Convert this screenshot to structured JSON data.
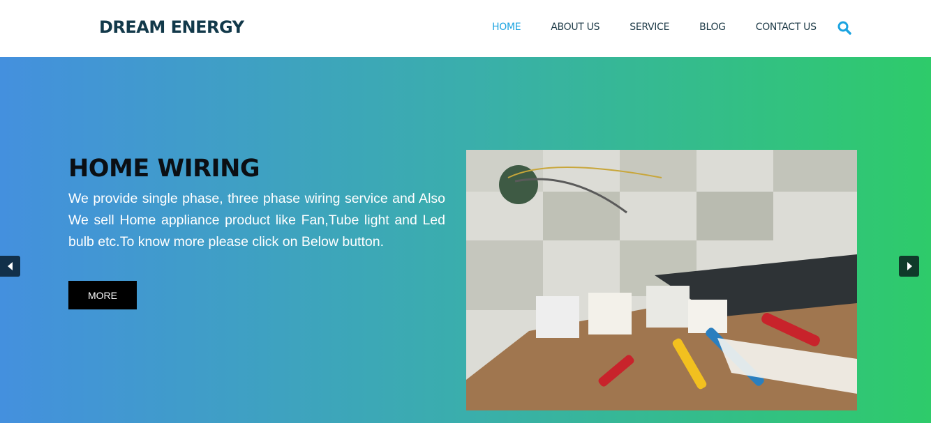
{
  "brand": "DREAM ENERGY",
  "nav": [
    {
      "label": "HOME",
      "active": true
    },
    {
      "label": "ABOUT US"
    },
    {
      "label": "SERVICE"
    },
    {
      "label": "BLOG"
    },
    {
      "label": "CONTACT US"
    }
  ],
  "colors": {
    "accent": "#1aa3e0",
    "brand": "#12394a",
    "gradient_start": "#4490de",
    "gradient_end": "#2ecb6a"
  },
  "slide": {
    "title": "HOME WIRING",
    "text": "We provide single phase, three phase wiring service and Also We sell Home appliance product like Fan,Tube light and Led bulb etc.To know more please click on Below button.",
    "button": "MORE"
  }
}
